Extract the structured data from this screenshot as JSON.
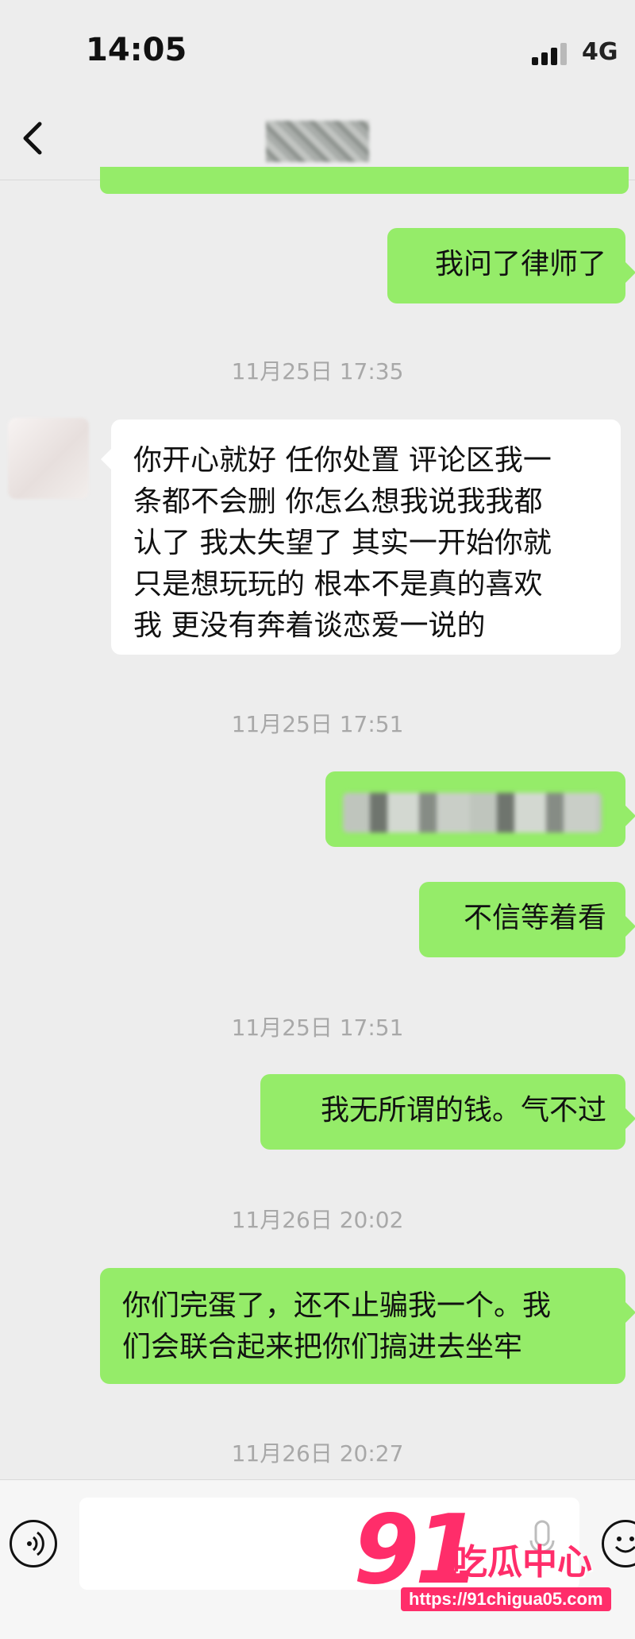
{
  "status_bar": {
    "time": "14:05",
    "network": "4G"
  },
  "nav": {
    "back_icon": "chevron-left-icon",
    "title_blurred": true
  },
  "messages": [
    {
      "kind": "out",
      "text": "我问了律师了"
    },
    {
      "kind": "timestamp",
      "text": "11月25日 17:35"
    },
    {
      "kind": "in",
      "lines": [
        "你开心就好 任你处置 评论区我一",
        "条都不会删 你怎么想我说我我都",
        "认了 我太失望了 其实一开始你就",
        "只是想玩玩的 根本不是真的喜欢",
        "我 更没有奔着谈恋爱一说的"
      ]
    },
    {
      "kind": "timestamp",
      "text": "11月25日 17:51"
    },
    {
      "kind": "out",
      "text": "",
      "blurred": true
    },
    {
      "kind": "out",
      "text": "不信等着看"
    },
    {
      "kind": "timestamp",
      "text": "11月25日 17:51"
    },
    {
      "kind": "out",
      "text": "我无所谓的钱。气不过"
    },
    {
      "kind": "timestamp",
      "text": "11月26日 20:02"
    },
    {
      "kind": "out",
      "lines": [
        "你们完蛋了，还不止骗我一个。我",
        "们会联合起来把你们搞进去坐牢"
      ]
    },
    {
      "kind": "timestamp",
      "text": "11月26日 20:27"
    }
  ],
  "input_bar": {
    "voice_icon": "voice-icon",
    "mic_icon": "microphone-icon",
    "emoji_icon": "emoji-icon"
  },
  "watermark": {
    "number": "91",
    "name": "吃瓜中心",
    "url": "https://91chigua05.com"
  },
  "colors": {
    "outgoing_bubble": "#95ec69",
    "incoming_bubble": "#ffffff",
    "background": "#ededed",
    "watermark": "#ff2d6a"
  }
}
